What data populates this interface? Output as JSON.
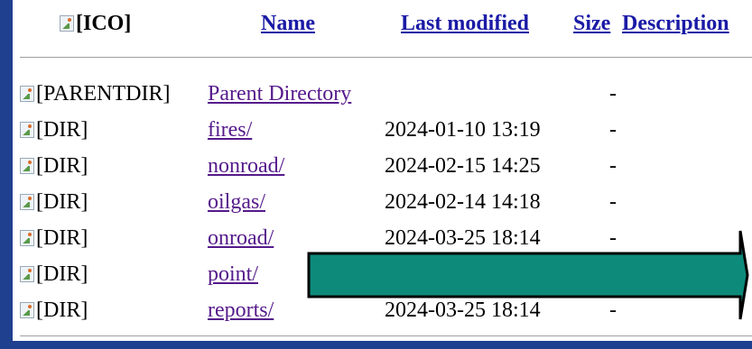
{
  "header": {
    "icon_alt": "[ICO]",
    "name": "Name",
    "last_modified": "Last modified",
    "size": "Size",
    "description": "Description"
  },
  "rows": [
    {
      "alt": "[PARENTDIR]",
      "name": "Parent Directory",
      "modified": "",
      "size": "-"
    },
    {
      "alt": "[DIR]",
      "name": "fires/",
      "modified": "2024-01-10 13:19",
      "size": "-"
    },
    {
      "alt": "[DIR]",
      "name": "nonroad/",
      "modified": "2024-02-15 14:25",
      "size": "-"
    },
    {
      "alt": "[DIR]",
      "name": "oilgas/",
      "modified": "2024-02-14 14:18",
      "size": "-"
    },
    {
      "alt": "[DIR]",
      "name": "onroad/",
      "modified": "2024-03-25 18:14",
      "size": "-"
    },
    {
      "alt": "[DIR]",
      "name": "point/",
      "modified": "",
      "size": ""
    },
    {
      "alt": "[DIR]",
      "name": "reports/",
      "modified": "2024-03-25 18:14",
      "size": "-"
    }
  ],
  "colors": {
    "frame": "#1f3f8f",
    "header_link": "#1a1aa6",
    "visited_link": "#551a8b",
    "arrow_fill": "#0e8a7a",
    "arrow_stroke": "#000000"
  },
  "annotation": {
    "icon": "right-arrow-icon"
  }
}
